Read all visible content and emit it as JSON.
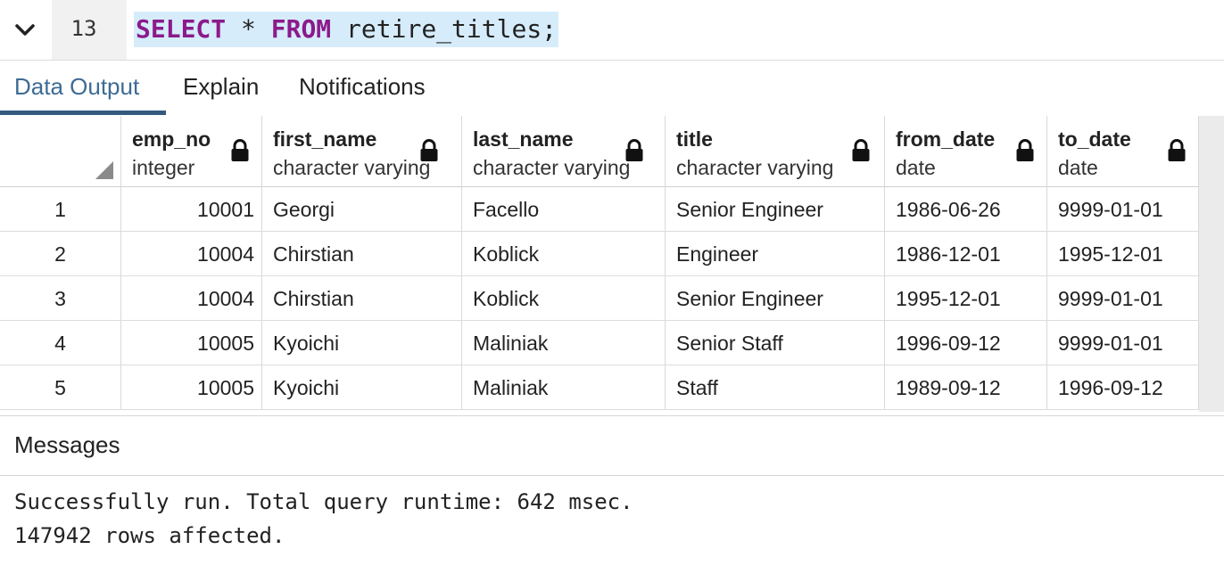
{
  "editor": {
    "line_number": "13",
    "query_keyword1": "SELECT",
    "query_middle": " * ",
    "query_keyword2": "FROM",
    "query_rest": " retire_titles;"
  },
  "tabs": [
    {
      "label": "Data Output",
      "active": true
    },
    {
      "label": "Explain",
      "active": false
    },
    {
      "label": "Notifications",
      "active": false
    }
  ],
  "columns": [
    {
      "name": "emp_no",
      "type": "integer"
    },
    {
      "name": "first_name",
      "type": "character varying"
    },
    {
      "name": "last_name",
      "type": "character varying"
    },
    {
      "name": "title",
      "type": "character varying"
    },
    {
      "name": "from_date",
      "type": "date"
    },
    {
      "name": "to_date",
      "type": "date"
    }
  ],
  "rows": [
    {
      "n": "1",
      "cells": [
        "10001",
        "Georgi",
        "Facello",
        "Senior Engineer",
        "1986-06-26",
        "9999-01-01"
      ]
    },
    {
      "n": "2",
      "cells": [
        "10004",
        "Chirstian",
        "Koblick",
        "Engineer",
        "1986-12-01",
        "1995-12-01"
      ]
    },
    {
      "n": "3",
      "cells": [
        "10004",
        "Chirstian",
        "Koblick",
        "Senior Engineer",
        "1995-12-01",
        "9999-01-01"
      ]
    },
    {
      "n": "4",
      "cells": [
        "10005",
        "Kyoichi",
        "Maliniak",
        "Senior Staff",
        "1996-09-12",
        "9999-01-01"
      ]
    },
    {
      "n": "5",
      "cells": [
        "10005",
        "Kyoichi",
        "Maliniak",
        "Staff",
        "1989-09-12",
        "1996-09-12"
      ]
    }
  ],
  "messages": {
    "title": "Messages",
    "line1": "Successfully run. Total query runtime: 642 msec.",
    "line2": "147942 rows affected."
  },
  "colors": {
    "active_tab": "#3d6b94",
    "tab_underline": "#33597f",
    "keyword": "#8b1a8b",
    "selection": "#d6ecfb"
  }
}
